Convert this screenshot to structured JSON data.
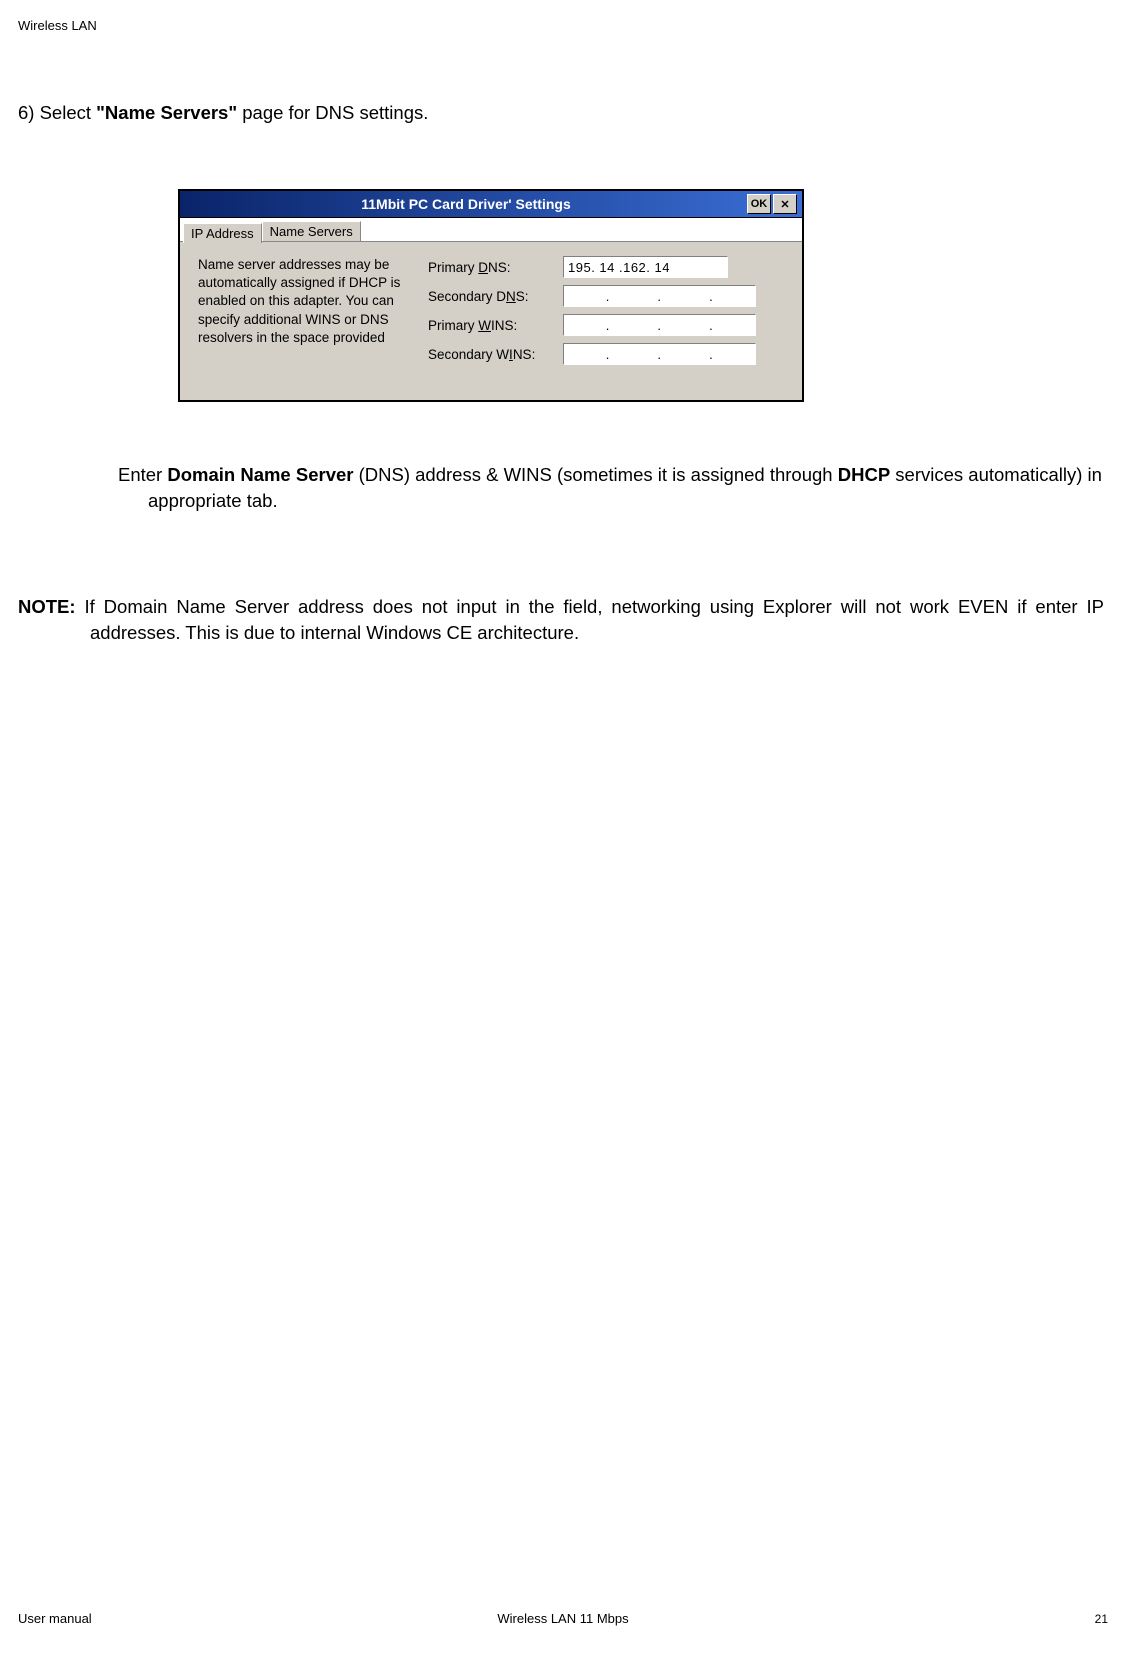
{
  "header": {
    "title": "Wireless LAN"
  },
  "body": {
    "step": "6) Select ",
    "step_bold": "\"Name Servers\"",
    "step_rest": " page for DNS settings."
  },
  "dialog": {
    "title": "11Mbit PC Card Driver' Settings",
    "ok_label": "OK",
    "close_symbol": "✕",
    "tabs": {
      "ip": "IP Address",
      "ns": "Name Servers"
    },
    "info_text": "Name server addresses may be automatically assigned if DHCP is enabled on this adapter. You can specify additional WINS or DNS resolvers in the space provided",
    "fields": {
      "primary_dns": {
        "label_pre": "Primary ",
        "label_ul": "D",
        "label_post": "NS:",
        "value": "195. 14 .162. 14"
      },
      "secondary_dns": {
        "label_pre": "Secondary D",
        "label_ul": "N",
        "label_post": "S:",
        "value": ""
      },
      "primary_wins": {
        "label_pre": "Primary ",
        "label_ul": "W",
        "label_post": "INS:",
        "value": ""
      },
      "secondary_wins": {
        "label_pre": "Secondary W",
        "label_ul": "I",
        "label_post": "NS:",
        "value": ""
      }
    }
  },
  "enter_line": {
    "pre": "Enter ",
    "b1": "Domain Name Server",
    "mid": "  (DNS) address & WINS (sometimes it is assigned through ",
    "b2": "DHCP",
    "post": " services automatically) in appropriate tab."
  },
  "note_line": {
    "label": "NOTE:",
    "text": " If Domain Name Server address does not input in the field, networking using Explorer will not work EVEN if enter IP addresses. This is due to internal Windows CE architecture."
  },
  "footer": {
    "left": "User manual",
    "center": "Wireless LAN 11 Mbps",
    "right": "21"
  }
}
